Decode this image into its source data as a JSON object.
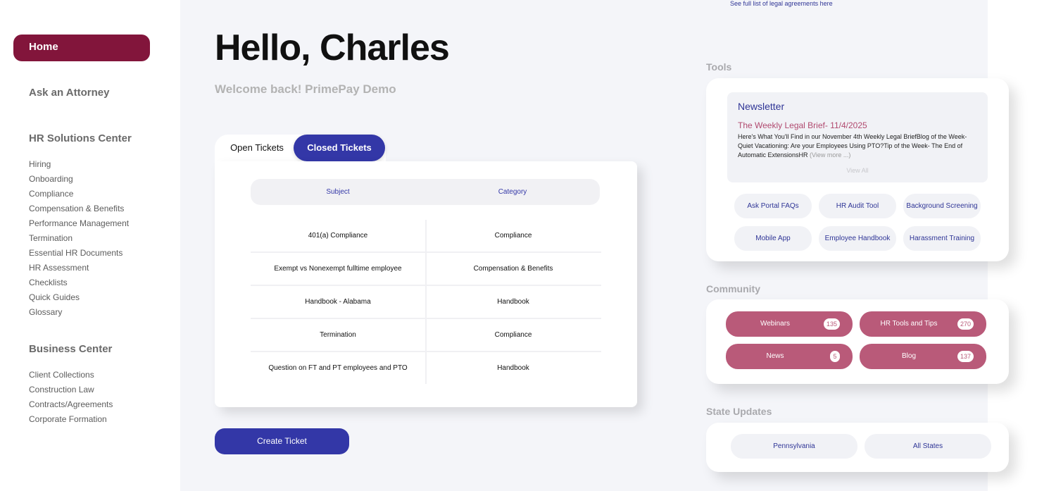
{
  "sidebar": {
    "home": "Home",
    "ask_attorney": "Ask an Attorney",
    "hr_solutions": {
      "heading": "HR Solutions Center",
      "items": [
        "Hiring",
        "Onboarding",
        "Compliance",
        "Compensation & Benefits",
        "Performance Management",
        "Termination",
        "Essential HR Documents",
        "HR Assessment",
        "Checklists",
        "Quick Guides",
        "Glossary"
      ]
    },
    "business_center": {
      "heading": "Business Center",
      "items": [
        "Client Collections",
        "Construction Law",
        "Contracts/Agreements",
        "Corporate Formation"
      ]
    }
  },
  "header": {
    "greeting": "Hello, Charles",
    "welcome": "Welcome back! PrimePay Demo",
    "legal_link": "See full list of legal agreements here"
  },
  "tickets": {
    "tab_open": "Open Tickets",
    "tab_closed": "Closed Tickets",
    "columns": [
      "Subject",
      "Category"
    ],
    "rows": [
      [
        "401(a) Compliance",
        "Compliance"
      ],
      [
        "Exempt vs Nonexempt fulltime employee",
        "Compensation & Benefits"
      ],
      [
        "Handbook - Alabama",
        "Handbook"
      ],
      [
        "Termination",
        "Compliance"
      ],
      [
        "Question on FT and PT employees and PTO",
        "Handbook"
      ]
    ],
    "create_button": "Create Ticket"
  },
  "tools": {
    "label": "Tools",
    "newsletter": {
      "title": "Newsletter",
      "subtitle": "The Weekly Legal Brief- 11/4/2025",
      "body": "Here's What You'll Find in our November 4th Weekly Legal BriefBlog of the Week- Quiet Vacationing: Are your Employees Using PTO?Tip of the Week- The End of Automatic ExtensionsHR ",
      "more": "(View more ...)",
      "view_all": "View All"
    },
    "buttons": [
      "Ask Portal FAQs",
      "HR Audit Tool",
      "Background Screening",
      "Mobile App",
      "Employee Handbook",
      "Harassment Training"
    ]
  },
  "community": {
    "label": "Community",
    "items": [
      {
        "label": "Webinars",
        "count": "135"
      },
      {
        "label": "HR Tools and Tips",
        "count": "270"
      },
      {
        "label": "News",
        "count": "5"
      },
      {
        "label": "Blog",
        "count": "137"
      }
    ]
  },
  "state_updates": {
    "label": "State Updates",
    "items": [
      "Pennsylvania",
      "All States"
    ]
  }
}
